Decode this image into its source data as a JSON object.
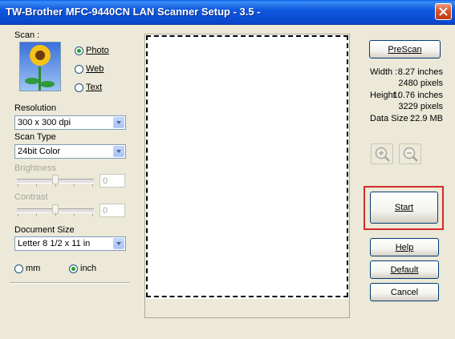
{
  "window": {
    "title": "TW-Brother MFC-9440CN LAN Scanner Setup - 3.5 -"
  },
  "scan": {
    "label": "Scan :",
    "options": [
      {
        "label": "Photo",
        "selected": true
      },
      {
        "label": "Web",
        "selected": false
      },
      {
        "label": "Text",
        "selected": false
      }
    ]
  },
  "resolution": {
    "label": "Resolution",
    "value": "300 x 300 dpi"
  },
  "scan_type": {
    "label": "Scan Type",
    "value": "24bit Color"
  },
  "brightness": {
    "label": "Brightness",
    "value": "0"
  },
  "contrast": {
    "label": "Contrast",
    "value": "0"
  },
  "document_size": {
    "label": "Document Size",
    "value": "Letter 8 1/2 x 11 in"
  },
  "units": {
    "options": [
      {
        "label": "mm",
        "selected": false
      },
      {
        "label": "inch",
        "selected": true
      }
    ]
  },
  "info": {
    "width_label": "Width :",
    "width_in": "8.27 inches",
    "width_px": "2480 pixels",
    "height_label": "Height :",
    "height_in": "10.76 inches",
    "height_px": "3229 pixels",
    "datasize_label": "Data Size :",
    "datasize": "22.9 MB"
  },
  "buttons": {
    "prescan": "PreScan",
    "start": "Start",
    "help": "Help",
    "default": "Default",
    "cancel": "Cancel"
  },
  "icons": {
    "zoom_in": "zoom-in-icon",
    "zoom_out": "zoom-out-icon",
    "close": "close-icon"
  },
  "colors": {
    "titlebar": "#0A4FD6",
    "highlight": "#D42A2A",
    "radio_dot": "#21A121"
  }
}
